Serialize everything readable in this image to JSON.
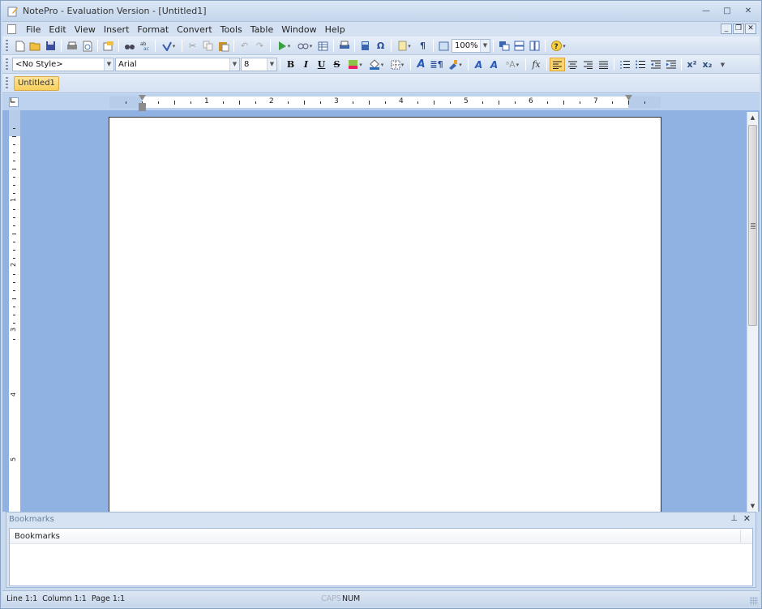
{
  "window": {
    "title": "NotePro - Evaluation Version - [Untitled1]",
    "controls": {
      "minimize": "—",
      "maximize": "□",
      "close": "✕"
    }
  },
  "menubar": {
    "items": [
      {
        "label": "File",
        "accel": "F"
      },
      {
        "label": "Edit",
        "accel": "E"
      },
      {
        "label": "View",
        "accel": "V"
      },
      {
        "label": "Insert",
        "accel": "I"
      },
      {
        "label": "Format",
        "accel": "m"
      },
      {
        "label": "Convert",
        "accel": "C"
      },
      {
        "label": "Tools",
        "accel": "T"
      },
      {
        "label": "Table",
        "accel": "a"
      },
      {
        "label": "Window",
        "accel": "W"
      },
      {
        "label": "Help",
        "accel": "H"
      }
    ],
    "mdi": {
      "minimize": "_",
      "restore": "❐",
      "close": "✕"
    }
  },
  "toolbar_standard": {
    "zoom_value": "100%",
    "buttons": [
      "new",
      "open",
      "save",
      "print",
      "print-preview",
      "properties",
      "find",
      "replace",
      "spell-check",
      "cut",
      "copy",
      "paste",
      "undo",
      "redo",
      "run",
      "link",
      "table",
      "printer",
      "calculator",
      "symbol",
      "page-setup",
      "show-paragraph",
      "zoom-page",
      "cascade",
      "tile-horizontal",
      "tile-vertical",
      "help"
    ]
  },
  "toolbar_format": {
    "style_value": "<No Style>",
    "font_value": "Arial",
    "size_value": "8",
    "labels": {
      "bold": "B",
      "italic": "I",
      "underline": "U",
      "strike": "S",
      "fx": "fx",
      "superscript": "x²",
      "subscript": "x₂"
    },
    "active_alignment": "left"
  },
  "doc_tabs": [
    {
      "label": "Untitled1",
      "active": true
    }
  ],
  "ruler": {
    "h_numbers": [
      "1",
      "2",
      "3",
      "4",
      "5",
      "6",
      "7"
    ],
    "v_numbers": [
      "1",
      "2",
      "3",
      "4",
      "5"
    ]
  },
  "bookmarks_panel": {
    "title": "Bookmarks",
    "column_header": "Bookmarks",
    "pin": "⊥",
    "close": "✕"
  },
  "statusbar": {
    "position": "Line 1:1  Column 1:1  Page 1:1",
    "caps": "CAPS",
    "num": "NUM"
  }
}
